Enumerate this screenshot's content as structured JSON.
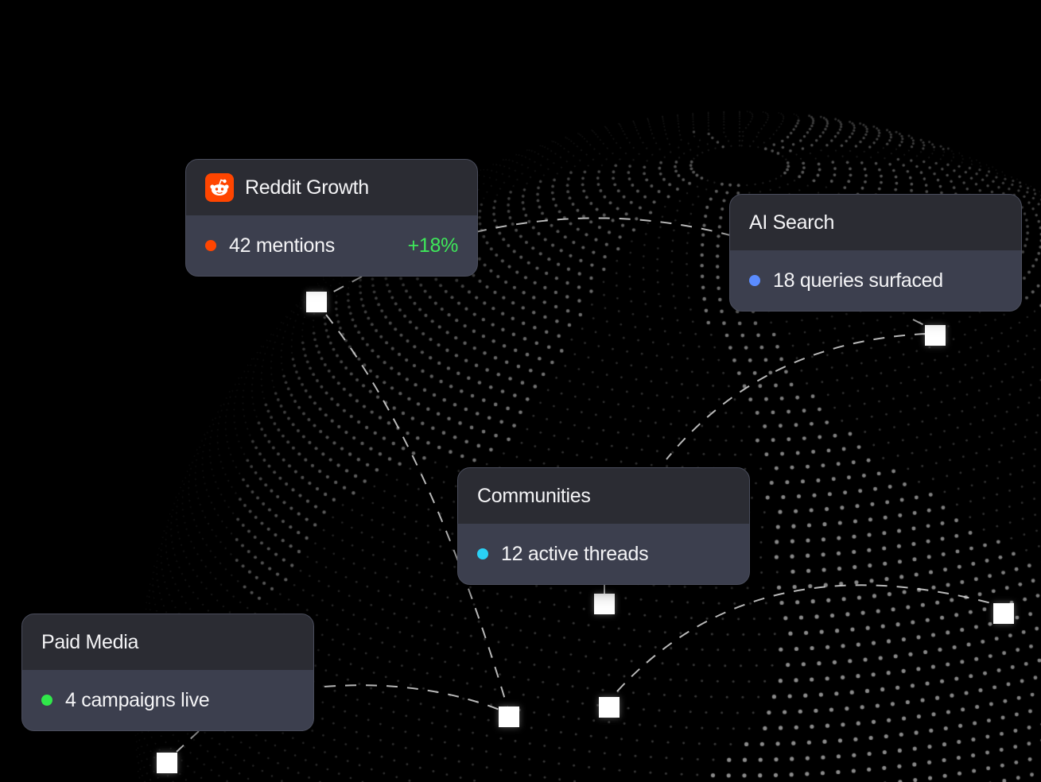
{
  "colors": {
    "background": "#000000",
    "card_head": "#2b2c33",
    "card_body": "#3c3f4e",
    "reddit_orange": "#ff4500",
    "change_positive": "#3ee85a",
    "dot_reddit": "#ff4500",
    "dot_ai_search": "#5b8cff",
    "dot_communities": "#2ad1f5",
    "dot_paid_media": "#30e84a",
    "globe_dots": "#ffffff"
  },
  "cards": {
    "reddit": {
      "icon": "reddit-icon",
      "title": "Reddit Growth",
      "metric": "42 mentions",
      "change": "+18%"
    },
    "ai_search": {
      "title": "AI Search",
      "metric": "18 queries surfaced"
    },
    "communities": {
      "title": "Communities",
      "metric": "12 active threads"
    },
    "paid_media": {
      "title": "Paid Media",
      "metric": "4 campaigns live"
    }
  }
}
